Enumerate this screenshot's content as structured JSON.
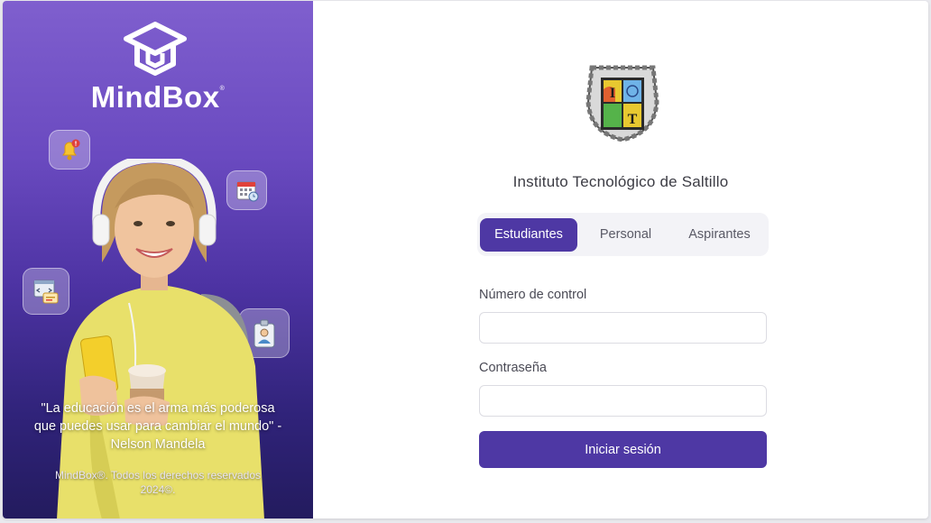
{
  "brand": {
    "name": "MindBox",
    "trademark": "®",
    "quote": "\"La educación es el arma más poderosa que puedes usar para cambiar el mundo\" - Nelson Mandela",
    "copyright": "MindBox®. Todos los derechos reservados 2024©."
  },
  "feature_icons": [
    "bell-notification-icon",
    "calendar-icon",
    "code-editor-icon",
    "id-badge-icon"
  ],
  "institution": {
    "name": "Instituto Tecnológico de Saltillo",
    "seal_letters": [
      "I",
      "T"
    ]
  },
  "tabs": [
    {
      "label": "Estudiantes",
      "active": true
    },
    {
      "label": "Personal",
      "active": false
    },
    {
      "label": "Aspirantes",
      "active": false
    }
  ],
  "form": {
    "control_number_label": "Número de control",
    "control_number_value": "",
    "password_label": "Contraseña",
    "password_value": "",
    "submit_label": "Iniciar sesión"
  },
  "colors": {
    "primary": "#4e38a4",
    "panel_top": "#7f5fce",
    "panel_bottom": "#231b5e"
  }
}
